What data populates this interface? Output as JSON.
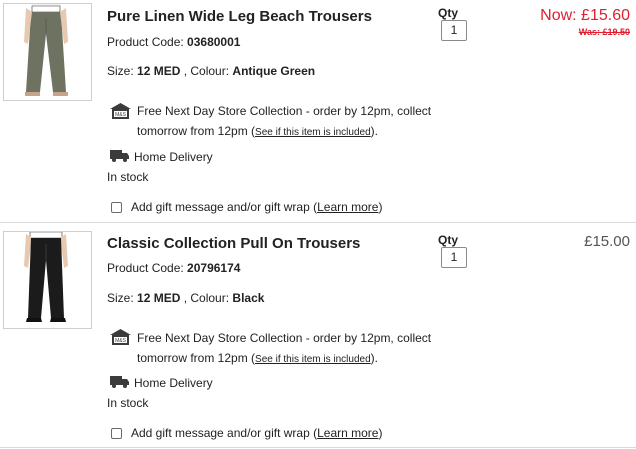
{
  "items": [
    {
      "title": "Pure Linen Wide Leg Beach Trousers",
      "code_label": "Product Code: ",
      "code": "03680001",
      "size_label": "Size: ",
      "size": "12 MED",
      "colour_label": " , Colour: ",
      "colour": "Antique Green",
      "qty_label": "Qty",
      "qty": "1",
      "price_now": "Now: £15.60",
      "price_was": "Was: £19.50",
      "price": "",
      "trouser_color": "#6e7361",
      "collection_line1": "Free Next Day Store Collection - order by 12pm, collect",
      "collection_line2_prefix": "tomorrow from 12pm (",
      "collection_link": "See if this item is included",
      "collection_line2_suffix": ").",
      "delivery": "Home Delivery",
      "stock": "In stock",
      "gift_prefix": "Add gift message and/or gift wrap (",
      "gift_link": "Learn more",
      "gift_suffix": ")"
    },
    {
      "title": "Classic Collection Pull On Trousers",
      "code_label": "Product Code: ",
      "code": "20796174",
      "size_label": "Size: ",
      "size": "12 MED",
      "colour_label": " , Colour: ",
      "colour": "Black",
      "qty_label": "Qty",
      "qty": "1",
      "price_now": "",
      "price_was": "",
      "price": "£15.00",
      "trouser_color": "#1b1b1b",
      "collection_line1": "Free Next Day Store Collection - order by 12pm, collect",
      "collection_line2_prefix": "tomorrow from 12pm (",
      "collection_link": "See if this item is included",
      "collection_line2_suffix": ").",
      "delivery": "Home Delivery",
      "stock": "In stock",
      "gift_prefix": "Add gift message and/or gift wrap (",
      "gift_link": "Learn more",
      "gift_suffix": ")"
    }
  ],
  "icons": {
    "store": "ms-store-icon",
    "delivery": "delivery-van-icon",
    "checkbox": "checkbox"
  },
  "colors": {
    "sale_red": "#e01e2f",
    "text": "#222222"
  }
}
